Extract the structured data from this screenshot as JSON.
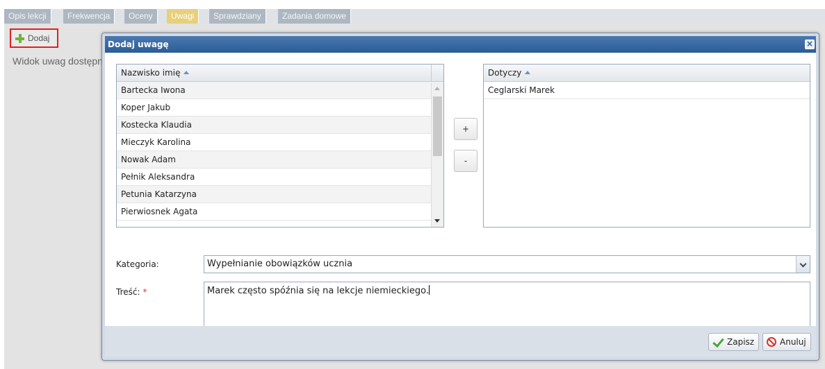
{
  "tabs": [
    {
      "label": "Opis lekcji"
    },
    {
      "label": "Frekwencja"
    },
    {
      "label": "Oceny"
    },
    {
      "label": "Uwagi",
      "active": true
    },
    {
      "label": "Sprawdziany"
    },
    {
      "label": "Zadania domowe"
    }
  ],
  "toolbar": {
    "add_label": "Dodaj"
  },
  "page": {
    "info_text": "Widok uwag dostępny"
  },
  "dialog": {
    "title": "Dodaj uwagę",
    "close_symbol": "×",
    "students_grid": {
      "header": "Nazwisko imię",
      "rows": [
        "Bartecka Iwona",
        "Koper Jakub",
        "Kostecka Klaudia",
        "Mieczyk Karolina",
        "Nowak Adam",
        "Pełnik Aleksandra",
        "Petunia Katarzyna",
        "Pierwiosnek Agata"
      ]
    },
    "add_button": "+",
    "remove_button": "-",
    "selected_grid": {
      "header": "Dotyczy",
      "rows": [
        "Ceglarski Marek"
      ]
    },
    "category": {
      "label": "Kategoria:",
      "value": "Wypełnianie obowiązków ucznia"
    },
    "content": {
      "label": "Treść:",
      "required_mark": "*",
      "value": "Marek często spóźnia się na lekcje niemieckiego."
    },
    "footer": {
      "save_label": "Zapisz",
      "cancel_label": "Anuluj"
    }
  },
  "colors": {
    "dialog_header": "#2c5c95",
    "active_tab": "#e8cf7a",
    "highlight_border": "#e02020"
  }
}
